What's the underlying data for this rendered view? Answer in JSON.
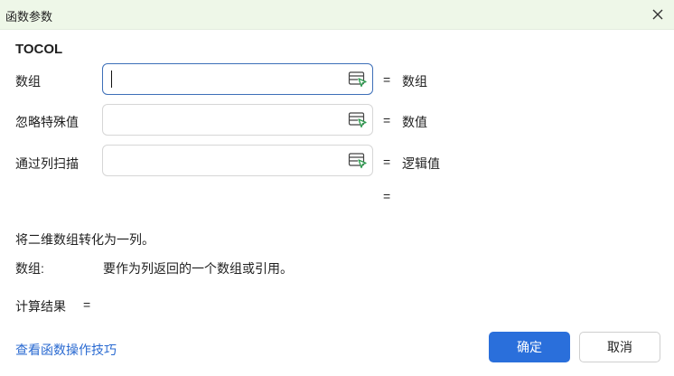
{
  "window": {
    "title": "函数参数",
    "close_icon": "close-icon"
  },
  "function_name": "TOCOL",
  "args": [
    {
      "label": "数组",
      "value": "",
      "ref_icon": "range-select-icon",
      "result": "数组",
      "focused": true
    },
    {
      "label": "忽略特殊值",
      "value": "",
      "ref_icon": "range-select-icon",
      "result": "数值",
      "focused": false
    },
    {
      "label": "通过列扫描",
      "value": "",
      "ref_icon": "range-select-icon",
      "result": "逻辑值",
      "focused": false
    }
  ],
  "overall_eq": "=",
  "eq_sign": "=",
  "description": "将二维数组转化为一列。",
  "param_help": {
    "name": "数组:",
    "text": "要作为列返回的一个数组或引用。"
  },
  "result": {
    "label": "计算结果",
    "eq": "="
  },
  "footer": {
    "help_link": "查看函数操作技巧",
    "ok_label": "确定",
    "cancel_label": "取消"
  },
  "colors": {
    "title_bar": "#eef7e8",
    "accent": "#2a6fdb",
    "link": "#2a6ad1",
    "active_border": "#3d6fb8"
  }
}
